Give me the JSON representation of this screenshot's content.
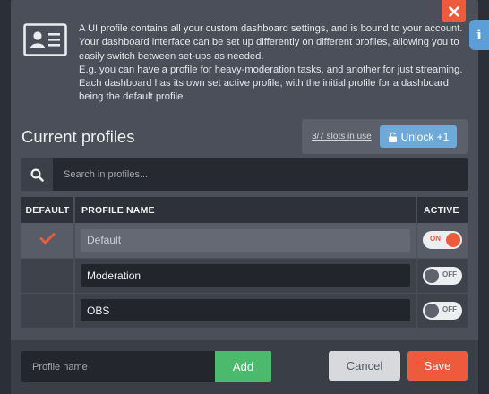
{
  "intro": {
    "icon": "profile-card-icon",
    "lines": [
      "A UI profile contains all your custom dashboard settings, and is bound to your account.",
      "Your dashboard interface can be set up differently on different profiles, allowing you to",
      "easily switch between set-ups as needed.",
      "E.g. you can have a profile for heavy-moderation tasks, and another for just streaming.",
      "Each dashboard has its own set active profile, with the initial profile for a dashboard",
      "being the default profile."
    ]
  },
  "header": {
    "title": "Current profiles",
    "slots_text": "3/7 slots in use",
    "unlock_label": "Unlock +1",
    "unlock_icon": "unlock-icon"
  },
  "search": {
    "icon": "search-icon",
    "placeholder": "Search in profiles..."
  },
  "table": {
    "columns": [
      "DEFAULT",
      "PROFILE NAME",
      "ACTIVE"
    ],
    "rows": [
      {
        "name": "Default",
        "is_default": true,
        "active": "ON"
      },
      {
        "name": "Moderation",
        "is_default": false,
        "active": "OFF"
      },
      {
        "name": "OBS",
        "is_default": false,
        "active": "OFF"
      }
    ]
  },
  "footer": {
    "new_profile_placeholder": "Profile name",
    "add_label": "Add",
    "cancel_label": "Cancel",
    "save_label": "Save"
  },
  "side_tab": {
    "label": "i"
  },
  "colors": {
    "accent": "#ee5a3c",
    "add_green": "#4cba6d",
    "unlock_blue": "#6ea9d8",
    "info_blue": "#5d9ed6",
    "modal_bg": "#4a4f59"
  }
}
